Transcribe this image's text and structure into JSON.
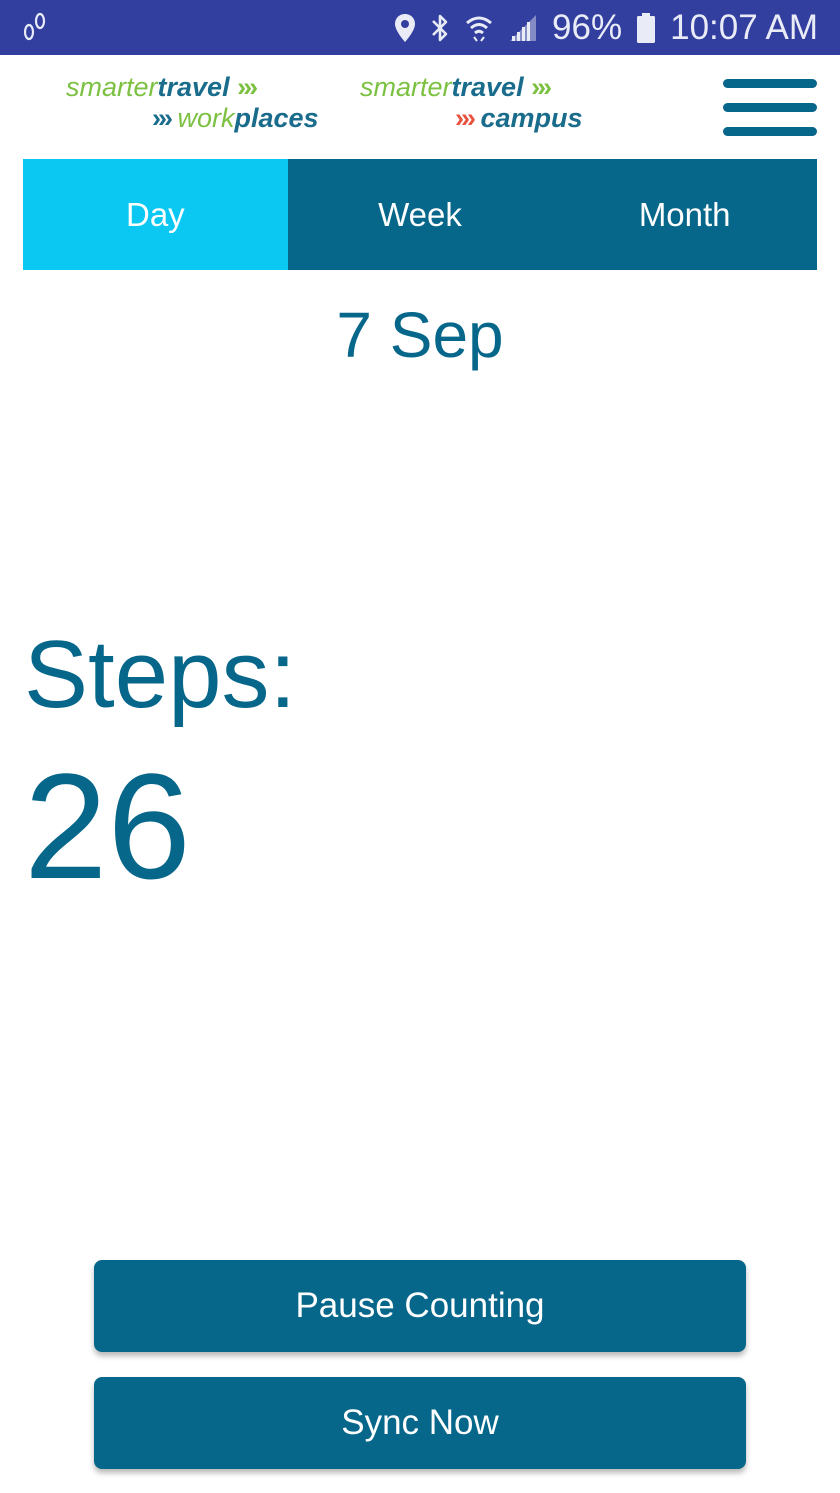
{
  "status_bar": {
    "battery": "96%",
    "time": "10:07 AM",
    "icons": [
      "footsteps-icon",
      "location-pin-icon",
      "bluetooth-icon",
      "wifi-icon",
      "signal-icon",
      "battery-icon"
    ]
  },
  "header": {
    "logo1": {
      "word1": "smarter",
      "word2": "travel",
      "chevrons": "›››",
      "word3": "work",
      "word4": "places"
    },
    "logo2": {
      "word1": "smarter",
      "word2": "travel",
      "chevrons": "›››",
      "word3": "campus"
    }
  },
  "tabs": [
    {
      "label": "Day",
      "active": true
    },
    {
      "label": "Week",
      "active": false
    },
    {
      "label": "Month",
      "active": false
    }
  ],
  "content": {
    "date": "7 Sep",
    "steps_label": "Steps:",
    "steps_value": "26"
  },
  "buttons": {
    "pause": "Pause Counting",
    "sync": "Sync Now"
  },
  "colors": {
    "status_bar": "#323f9f",
    "primary": "#07678a",
    "active_tab": "#0ac8f2",
    "logo_green": "#7cc142",
    "logo_red": "#e8533f"
  }
}
